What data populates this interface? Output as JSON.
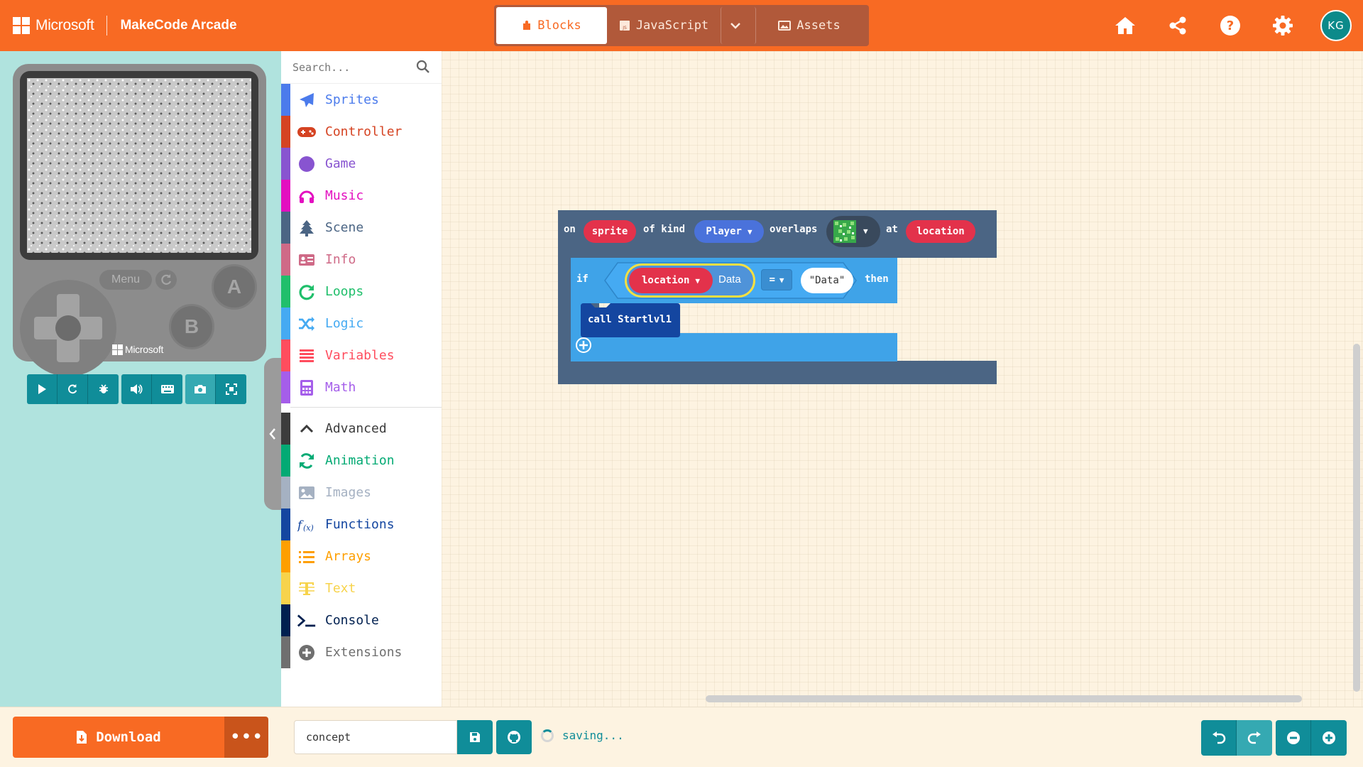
{
  "header": {
    "brand": "Microsoft",
    "app_title": "MakeCode Arcade",
    "tabs": {
      "blocks": "Blocks",
      "javascript": "JavaScript",
      "assets": "Assets"
    },
    "avatar_initials": "KG",
    "accent_color": "#f86a23",
    "icons": [
      "home-icon",
      "share-icon",
      "help-icon",
      "settings-icon"
    ]
  },
  "simulator": {
    "menu_label": "Menu",
    "button_a": "A",
    "button_b": "B",
    "device_brand": "Microsoft",
    "toolbar_icons": [
      "play-icon",
      "restart-icon",
      "debug-icon",
      "sound-icon",
      "keyboard-icon",
      "screenshot-icon",
      "fullscreen-icon"
    ]
  },
  "toolbox": {
    "search_placeholder": "Search...",
    "categories": [
      {
        "label": "Sprites",
        "color": "#4b7bec",
        "icon": "paper-plane-icon"
      },
      {
        "label": "Controller",
        "color": "#d54322",
        "icon": "gamepad-icon"
      },
      {
        "label": "Game",
        "color": "#8854d0",
        "icon": "circle-icon"
      },
      {
        "label": "Music",
        "color": "#e30fc0",
        "icon": "headphones-icon"
      },
      {
        "label": "Scene",
        "color": "#4b6584",
        "icon": "tree-icon"
      },
      {
        "label": "Info",
        "color": "#cf6a87",
        "icon": "id-card-icon"
      },
      {
        "label": "Loops",
        "color": "#20bf6b",
        "icon": "loop-icon"
      },
      {
        "label": "Logic",
        "color": "#45aaf2",
        "icon": "shuffle-icon"
      },
      {
        "label": "Variables",
        "color": "#ff4d5e",
        "icon": "list-icon"
      },
      {
        "label": "Math",
        "color": "#a55eea",
        "icon": "calculator-icon"
      }
    ],
    "advanced": [
      {
        "label": "Advanced",
        "color": "#3c3c3c",
        "icon": "chevron-up-icon"
      },
      {
        "label": "Animation",
        "color": "#03aa74",
        "icon": "refresh-icon"
      },
      {
        "label": "Images",
        "color": "#a5b1c2",
        "icon": "image-icon"
      },
      {
        "label": "Functions",
        "color": "#1446a0",
        "icon": "function-icon"
      },
      {
        "label": "Arrays",
        "color": "#fe9f00",
        "icon": "array-list-icon"
      },
      {
        "label": "Text",
        "color": "#f7d34b",
        "icon": "text-icon"
      },
      {
        "label": "Console",
        "color": "#002050",
        "icon": "terminal-icon"
      },
      {
        "label": "Extensions",
        "color": "#6f6f6f",
        "icon": "plus-circle-icon"
      }
    ]
  },
  "workspace": {
    "event_block": {
      "on": "on",
      "sprite": "sprite",
      "of_kind": "of kind",
      "kind_value": "Player",
      "overlaps": "overlaps",
      "at": "at",
      "location": "location"
    },
    "if_block": {
      "if": "if",
      "location": "location",
      "data": "Data",
      "operator": "=",
      "string_value": "\"Data\"",
      "then": "then"
    },
    "call_block": {
      "label": "call Startlvl1"
    }
  },
  "footer": {
    "download_label": "Download",
    "more_label": "•••",
    "project_name": "concept",
    "status": "saving..."
  }
}
